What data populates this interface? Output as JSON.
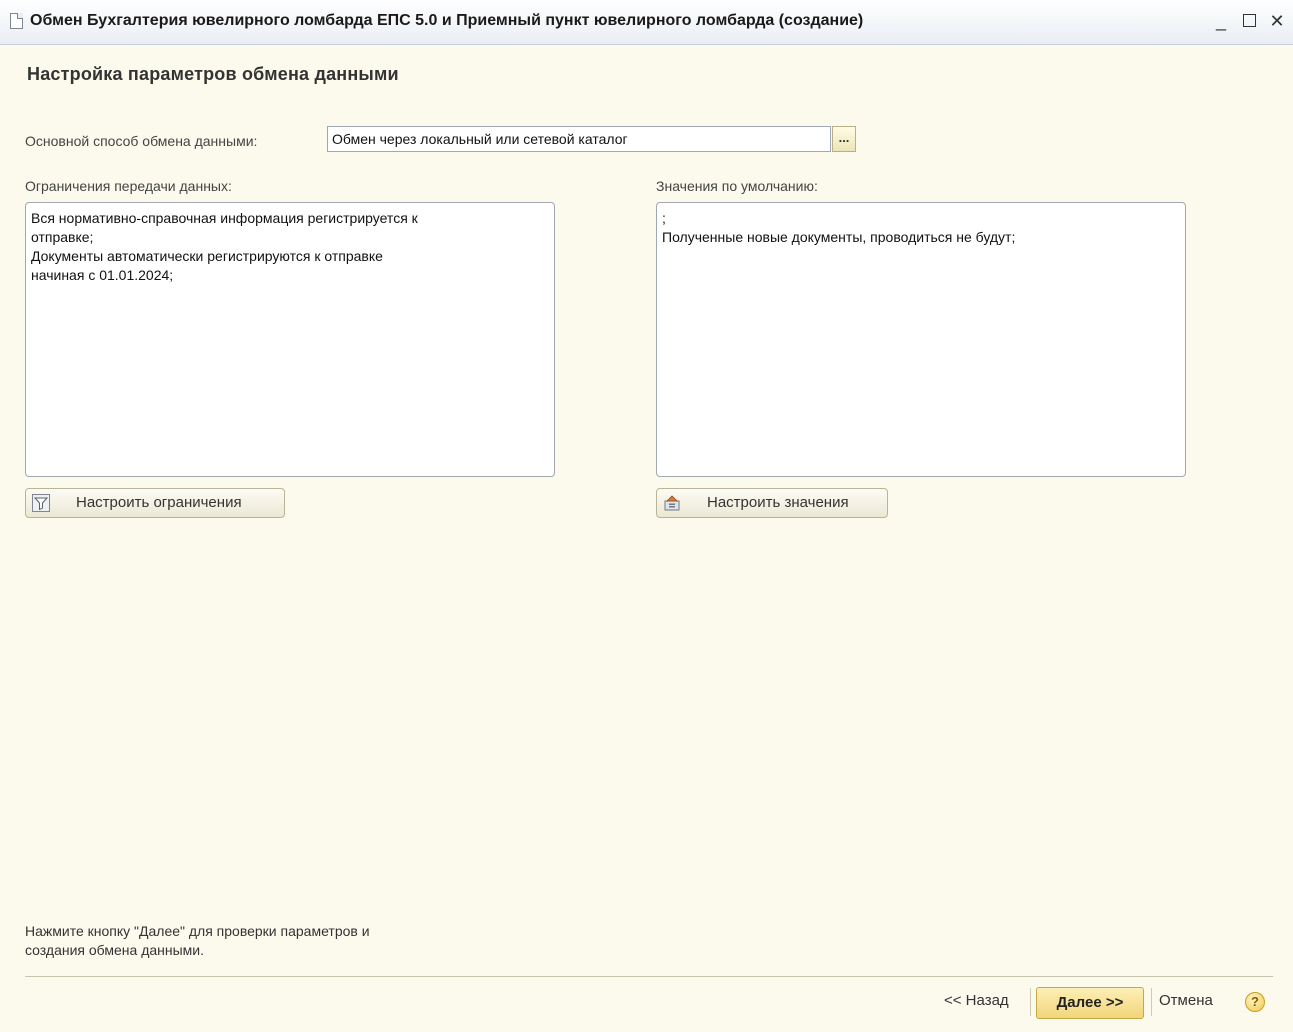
{
  "window": {
    "title": "Обмен Бухгалтерия ювелирного ломбарда ЕПС 5.0 и Приемный пункт ювелирного ломбарда (создание)",
    "minimize_glyph": "_",
    "close_glyph": "✕"
  },
  "page": {
    "title": "Настройка параметров обмена данными"
  },
  "method": {
    "label": "Основной способ обмена данными:",
    "value": "Обмен через локальный или сетевой каталог",
    "choose_label": "..."
  },
  "restrictions": {
    "label": "Ограничения передачи данных:",
    "text": "Вся нормативно-справочная информация регистрируется к\nотправке;\nДокументы автоматически регистрируются к отправке\nначиная с 01.01.2024;",
    "button_label": "Настроить ограничения"
  },
  "defaults": {
    "label": "Значения по умолчанию:",
    "text": ";\nПолученные новые документы, проводиться не будут;",
    "button_label": "Настроить значения"
  },
  "hint": {
    "line1": "Нажмите кнопку \"Далее\" для проверки параметров и",
    "line2": "создания обмена данными."
  },
  "nav": {
    "back_label": "<< Назад",
    "next_label": "Далее >>",
    "cancel_label": "Отмена",
    "help_label": "?"
  }
}
